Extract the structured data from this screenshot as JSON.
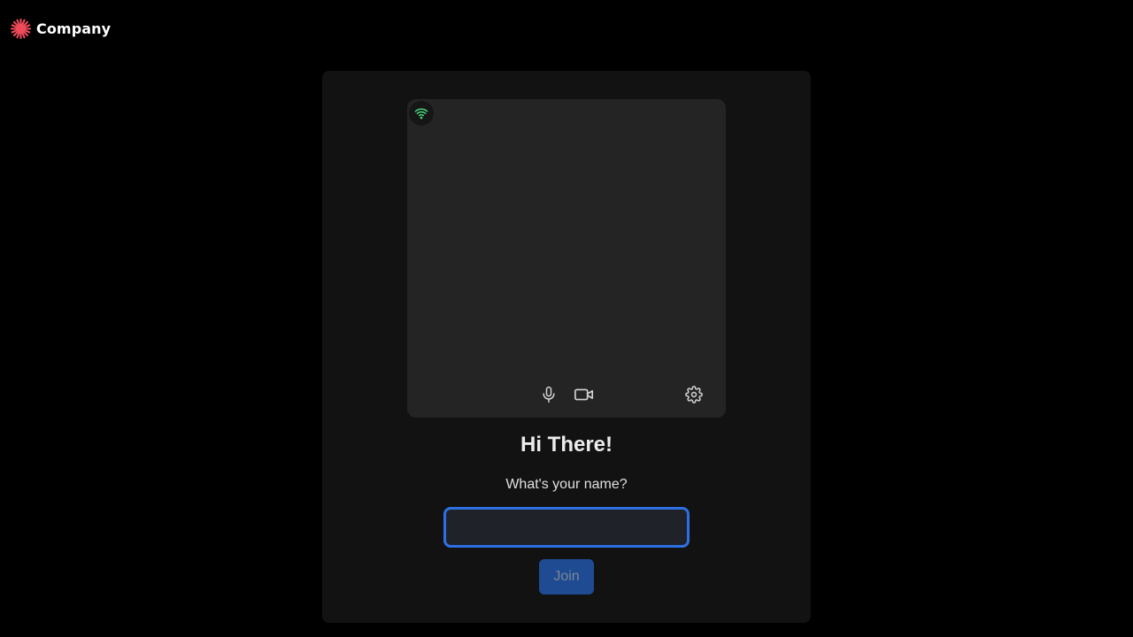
{
  "brand": {
    "name": "Company",
    "logo_icon": "asterisk-logo-icon",
    "logo_color": "#ef4b5b"
  },
  "preview": {
    "connection_icon": "wifi-signal-icon",
    "connection_color": "#4ade80",
    "controls": [
      {
        "icon": "microphone-icon"
      },
      {
        "icon": "video-camera-icon"
      },
      {
        "icon": "gear-icon"
      }
    ]
  },
  "greeting": "Hi There!",
  "name_prompt": "What's your name?",
  "name_input": {
    "value": "",
    "placeholder": ""
  },
  "join_label": "Join",
  "colors": {
    "background": "#000000",
    "card": "#121212",
    "preview": "#242424",
    "input_focus_border": "#2f6fe4",
    "join_button": "#1e4b92"
  }
}
